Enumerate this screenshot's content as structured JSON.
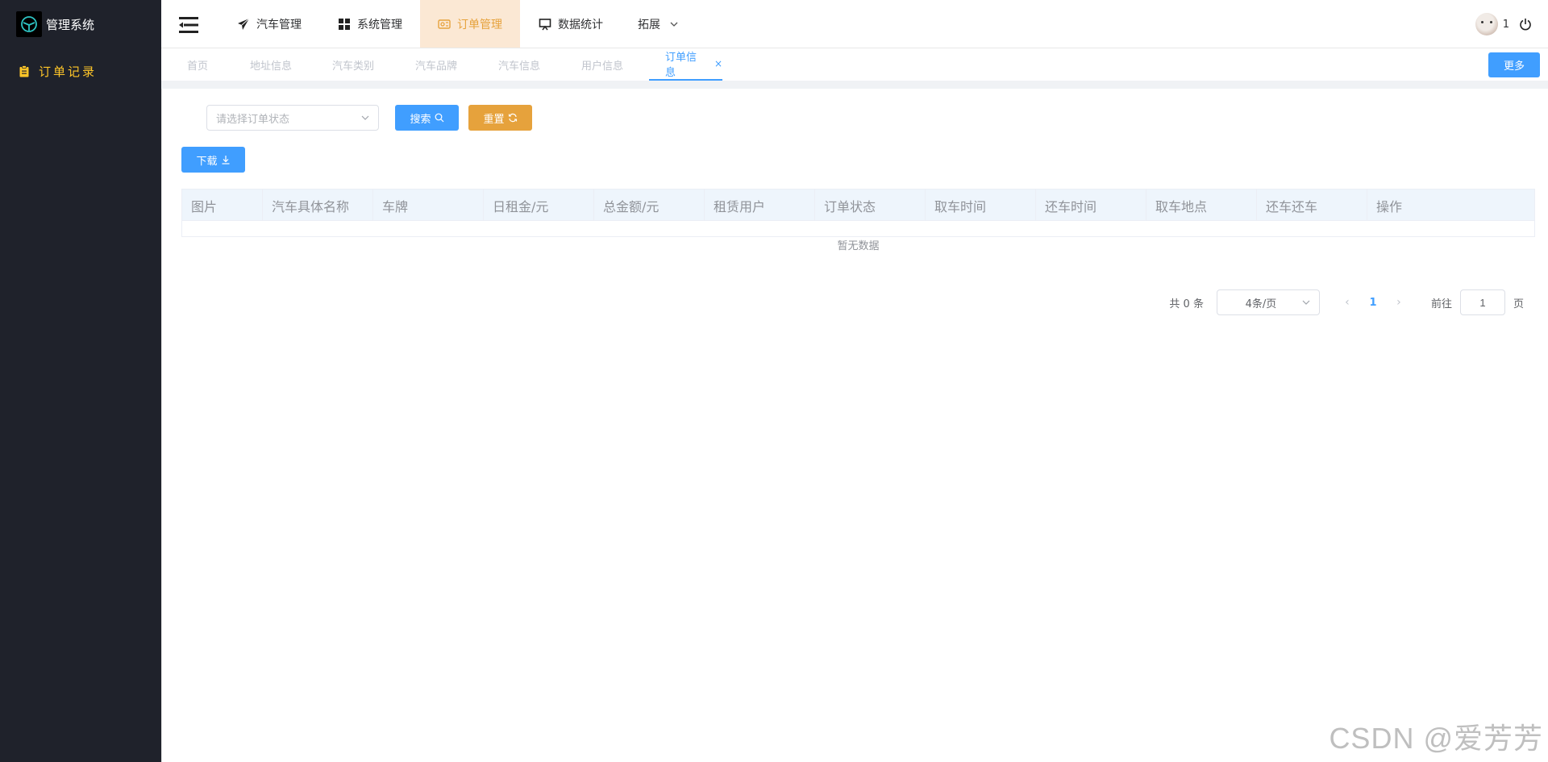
{
  "app": {
    "title": "管理系统"
  },
  "sidebar": {
    "items": [
      {
        "label": "订单记录",
        "icon": "clipboard-icon"
      }
    ]
  },
  "topnav": {
    "items": [
      {
        "label": "汽车管理",
        "icon": "paper-plane-icon"
      },
      {
        "label": "系统管理",
        "icon": "grid-icon"
      },
      {
        "label": "订单管理",
        "icon": "ticket-icon"
      },
      {
        "label": "数据统计",
        "icon": "presentation-icon"
      },
      {
        "label": "拓展",
        "icon": "chevron-down-icon"
      }
    ],
    "active_index": 2,
    "user": {
      "count": "1"
    }
  },
  "tabs": {
    "items": [
      "首页",
      "地址信息",
      "汽车类别",
      "汽车品牌",
      "汽车信息",
      "用户信息",
      "订单信息"
    ],
    "active_index": 6,
    "close_glyph": "×",
    "more_label": "更多"
  },
  "filters": {
    "status_placeholder": "请选择订单状态",
    "search_label": "搜索",
    "reset_label": "重置",
    "download_label": "下载"
  },
  "table": {
    "columns": [
      "图片",
      "汽车具体名称",
      "车牌",
      "日租金/元",
      "总金额/元",
      "租赁用户",
      "订单状态",
      "取车时间",
      "还车时间",
      "取车地点",
      "还车还车",
      "操作"
    ],
    "empty_text": "暂无数据"
  },
  "pagination": {
    "total_text": "共 0 条",
    "page_size": "4条/页",
    "current_page": "1",
    "goto_label": "前往",
    "goto_value": "1",
    "goto_suffix": "页"
  },
  "watermark": "CSDN @爱芳芳",
  "colors": {
    "primary": "#409eff",
    "warning": "#e6a23c",
    "sidebar_bg": "#1f222b",
    "sidebar_active": "#ffc628"
  }
}
